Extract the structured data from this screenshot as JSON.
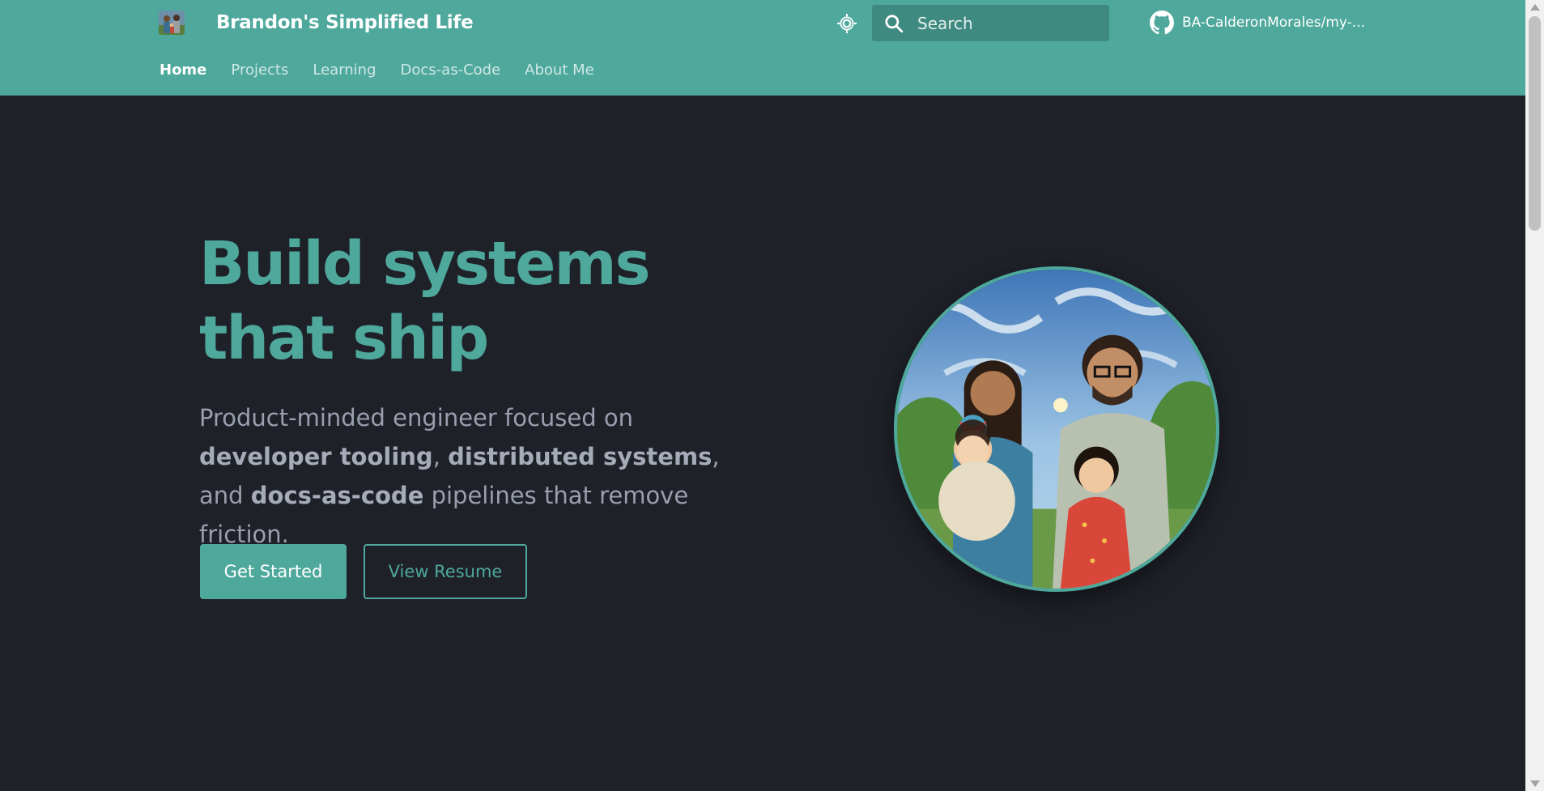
{
  "header": {
    "site_title": "Brandon's Simplified Life",
    "logo_icon": "family-logo-image",
    "theme_toggle_icon": "sun-icon",
    "search": {
      "placeholder": "Search",
      "icon": "search-icon"
    },
    "repo": {
      "icon": "github-icon",
      "label": "BA-CalderonMorales/my-..."
    },
    "bg_color": "#4ea89c"
  },
  "tabs": [
    {
      "label": "Home",
      "active": true
    },
    {
      "label": "Projects",
      "active": false
    },
    {
      "label": "Learning",
      "active": false
    },
    {
      "label": "Docs-as-Code",
      "active": false
    },
    {
      "label": "About Me",
      "active": false
    }
  ],
  "hero": {
    "title": "Build systems that ship",
    "sub_intro": "Product-minded engineer focused on",
    "sub_b1": "developer tooling",
    "sub_comma": ",",
    "sub_b2": "distributed systems",
    "sub_and": ", and",
    "sub_b3": "docs-as-code",
    "sub_end": "pipelines that remove friction.",
    "primary_button": "Get Started",
    "secondary_button": "View Resume",
    "portrait_icon": "family-portrait-image"
  },
  "colors": {
    "accent": "#4ea89c",
    "background": "#1f2129",
    "body_text": "#9a9fad"
  }
}
